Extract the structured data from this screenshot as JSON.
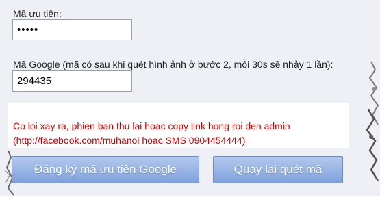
{
  "form": {
    "priority_code_label": "Mã ưu tiên:",
    "priority_code_value": "•••••",
    "google_code_label": "Mã Google (mã có sau khi quét hình ảnh ở bước 2, mỗi 30s sẽ nhảy 1 lần):",
    "google_code_value": "294435"
  },
  "error": {
    "line1": "Co loi xay ra, phien ban thu lai hoac copy link hong roi den admin",
    "line2": "(http://facebook.com/muhanoi hoac SMS 0904454444)"
  },
  "buttons": {
    "register_label": "Đăng ký mã ưu tiên Google",
    "rescan_label": "Quay lại quét mã"
  },
  "colors": {
    "panel_bg": "#eef0f6",
    "error_text": "#d40000",
    "button_bg": "#8aabe0"
  }
}
